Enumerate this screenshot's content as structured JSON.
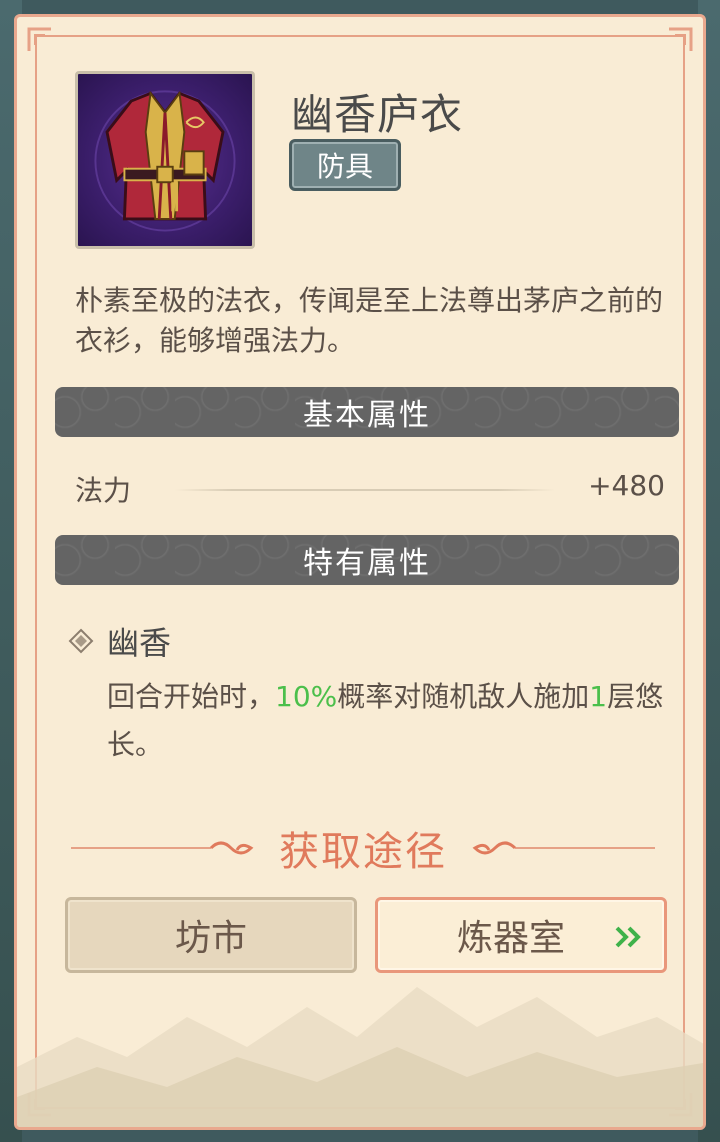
{
  "item": {
    "name": "幽香庐衣",
    "type": "防具",
    "icon": "robe-icon",
    "description": "朴素至极的法衣，传闻是至上法尊出茅庐之前的衣衫，能够增强法力。"
  },
  "basic_section": {
    "title": "基本属性",
    "stats": [
      {
        "name": "法力",
        "value": "+480"
      }
    ]
  },
  "special_section": {
    "title": "特有属性",
    "traits": [
      {
        "name": "幽香",
        "desc_prefix": "回合开始时，",
        "desc_highlight1": "10%",
        "desc_mid": "概率对随机敌人施加",
        "desc_highlight2": "1",
        "desc_suffix": "层悠长。"
      }
    ]
  },
  "obtain": {
    "title": "获取途径",
    "buttons": [
      {
        "label": "坊市"
      },
      {
        "label": "炼器室",
        "icon": "double-chevron-right-icon"
      }
    ]
  },
  "colors": {
    "card_bg": "#f9ecd5",
    "border": "#e9a88e",
    "accent": "#e07a5c",
    "highlight": "#4bbf4b",
    "section_bar": "#646464"
  }
}
